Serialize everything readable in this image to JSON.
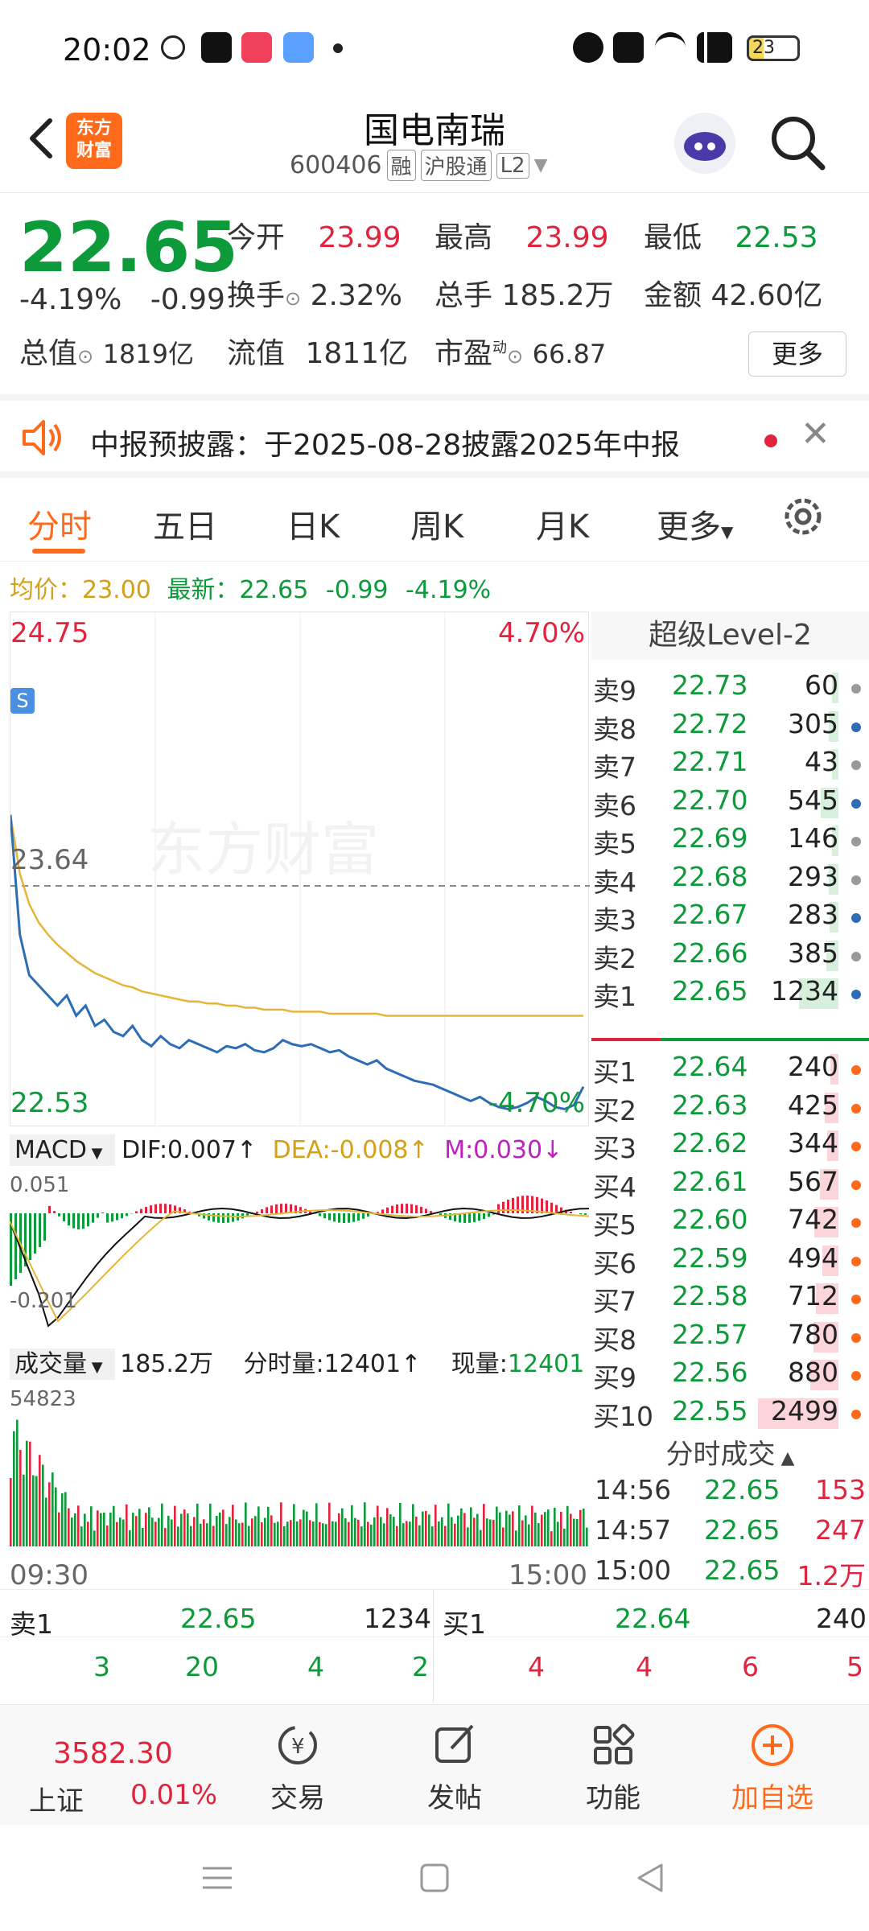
{
  "status_bar": {
    "time": "20:02",
    "battery": "23"
  },
  "header": {
    "logo_text": "东方财富",
    "title": "国电南瑞",
    "code": "600406",
    "tags": [
      "融",
      "沪股通",
      "L2"
    ]
  },
  "quote": {
    "price": "22.65",
    "change_pct": "-4.19%",
    "change": "-0.99",
    "open_label": "今开",
    "open": "23.99",
    "high_label": "最高",
    "high": "23.99",
    "low_label": "最低",
    "low": "22.53",
    "turnover_label": "换手",
    "turnover": "2.32%",
    "volume_label": "总手",
    "volume": "185.2万",
    "amount_label": "金额",
    "amount": "42.60亿",
    "mktcap_label": "总值",
    "mktcap": "1819亿",
    "float_label": "流值",
    "float_cap": "1811亿",
    "pe_label": "市盈",
    "pe_sup": "动",
    "pe": "66.87",
    "more_label": "更多"
  },
  "notice": {
    "text": "中报预披露：于2025-08-28披露2025年中报"
  },
  "tabs": [
    "分时",
    "五日",
    "日K",
    "周K",
    "月K",
    "更多"
  ],
  "chart_info": {
    "avg_label": "均价：",
    "avg": "23.00",
    "latest_label": "最新：",
    "latest": "22.65",
    "change": "-0.99",
    "change_pct": "-4.19%"
  },
  "chart_data": {
    "type": "line",
    "y_max_label": "24.75",
    "y_min_label": "22.53",
    "pct_top": "4.70%",
    "pct_bottom": "-4.70%",
    "ref_label": "23.64",
    "x_labels": [
      "09:30",
      "15:00"
    ],
    "watermark": "东方财富",
    "ylim": [
      22.53,
      24.75
    ],
    "ref": 23.64,
    "series": [
      {
        "values": [
          23.99,
          23.4,
          23.2,
          23.15,
          23.1,
          23.05,
          23.1,
          23.0,
          23.05,
          22.95,
          22.98,
          22.92,
          22.9,
          22.95,
          22.88,
          22.85,
          22.9,
          22.86,
          22.84,
          22.88,
          22.86,
          22.84,
          22.82,
          22.85,
          22.84,
          22.86,
          22.83,
          22.82,
          22.84,
          22.88,
          22.86,
          22.85,
          22.86,
          22.84,
          22.82,
          22.83,
          22.8,
          22.78,
          22.76,
          22.78,
          22.74,
          22.72,
          22.7,
          22.68,
          22.67,
          22.66,
          22.64,
          22.62,
          22.6,
          22.58,
          22.6,
          22.57,
          22.55,
          22.54,
          22.55,
          22.57,
          22.6,
          22.58,
          22.55,
          22.54,
          22.56,
          22.65
        ]
      },
      {
        "values": [
          23.99,
          23.7,
          23.55,
          23.46,
          23.4,
          23.35,
          23.31,
          23.27,
          23.24,
          23.21,
          23.19,
          23.17,
          23.15,
          23.14,
          23.12,
          23.11,
          23.1,
          23.09,
          23.08,
          23.07,
          23.07,
          23.06,
          23.06,
          23.05,
          23.05,
          23.04,
          23.04,
          23.03,
          23.03,
          23.03,
          23.02,
          23.02,
          23.02,
          23.02,
          23.01,
          23.01,
          23.01,
          23.01,
          23.01,
          23.01,
          23.0,
          23.0,
          23.0,
          23.0,
          23.0,
          23.0,
          23.0,
          23.0,
          23.0,
          23.0,
          23.0,
          23.0,
          23.0,
          23.0,
          23.0,
          23.0,
          23.0,
          23.0,
          23.0,
          23.0,
          23.0,
          23.0
        ]
      }
    ]
  },
  "macd": {
    "label": "MACD",
    "dif": "DIF:0.007",
    "dea": "DEA:-0.008",
    "m": "M:0.030",
    "top": "0.051",
    "bottom": "-0.201"
  },
  "volume": {
    "label": "成交量",
    "total": "185.2万",
    "minute_label": "分时量:12401",
    "now_label": "现量:",
    "now": "12401",
    "max": "54823"
  },
  "orderbook": {
    "title": "超级Level-2",
    "sells": [
      {
        "label": "卖9",
        "price": "22.73",
        "vol": "60"
      },
      {
        "label": "卖8",
        "price": "22.72",
        "vol": "305"
      },
      {
        "label": "卖7",
        "price": "22.71",
        "vol": "43"
      },
      {
        "label": "卖6",
        "price": "22.70",
        "vol": "545"
      },
      {
        "label": "卖5",
        "price": "22.69",
        "vol": "146"
      },
      {
        "label": "卖4",
        "price": "22.68",
        "vol": "293"
      },
      {
        "label": "卖3",
        "price": "22.67",
        "vol": "283"
      },
      {
        "label": "卖2",
        "price": "22.66",
        "vol": "385"
      },
      {
        "label": "卖1",
        "price": "22.65",
        "vol": "1234"
      }
    ],
    "buys": [
      {
        "label": "买1",
        "price": "22.64",
        "vol": "240"
      },
      {
        "label": "买2",
        "price": "22.63",
        "vol": "425"
      },
      {
        "label": "买3",
        "price": "22.62",
        "vol": "344"
      },
      {
        "label": "买4",
        "price": "22.61",
        "vol": "567"
      },
      {
        "label": "买5",
        "price": "22.60",
        "vol": "742"
      },
      {
        "label": "买6",
        "price": "22.59",
        "vol": "494"
      },
      {
        "label": "买7",
        "price": "22.58",
        "vol": "712"
      },
      {
        "label": "买8",
        "price": "22.57",
        "vol": "780"
      },
      {
        "label": "买9",
        "price": "22.56",
        "vol": "880"
      },
      {
        "label": "买10",
        "price": "22.55",
        "vol": "2499"
      }
    ],
    "ticks_title": "分时成交",
    "ticks": [
      {
        "time": "14:56",
        "price": "22.65",
        "vol": "153"
      },
      {
        "time": "14:57",
        "price": "22.65",
        "vol": "247"
      },
      {
        "time": "15:00",
        "price": "22.65",
        "vol": "1.2万"
      }
    ]
  },
  "summary": {
    "sell_label": "卖1",
    "sell_price": "22.65",
    "sell_vol": "1234",
    "buy_label": "买1",
    "buy_price": "22.64",
    "buy_vol": "240",
    "sell_queue": [
      "3",
      "20",
      "4",
      "2"
    ],
    "buy_queue": [
      "4",
      "4",
      "6",
      "5"
    ]
  },
  "bottom_nav": {
    "index_value": "3582.30",
    "index_name": "上证",
    "index_pct": "0.01%",
    "items": [
      "交易",
      "发帖",
      "功能",
      "加自选"
    ]
  }
}
